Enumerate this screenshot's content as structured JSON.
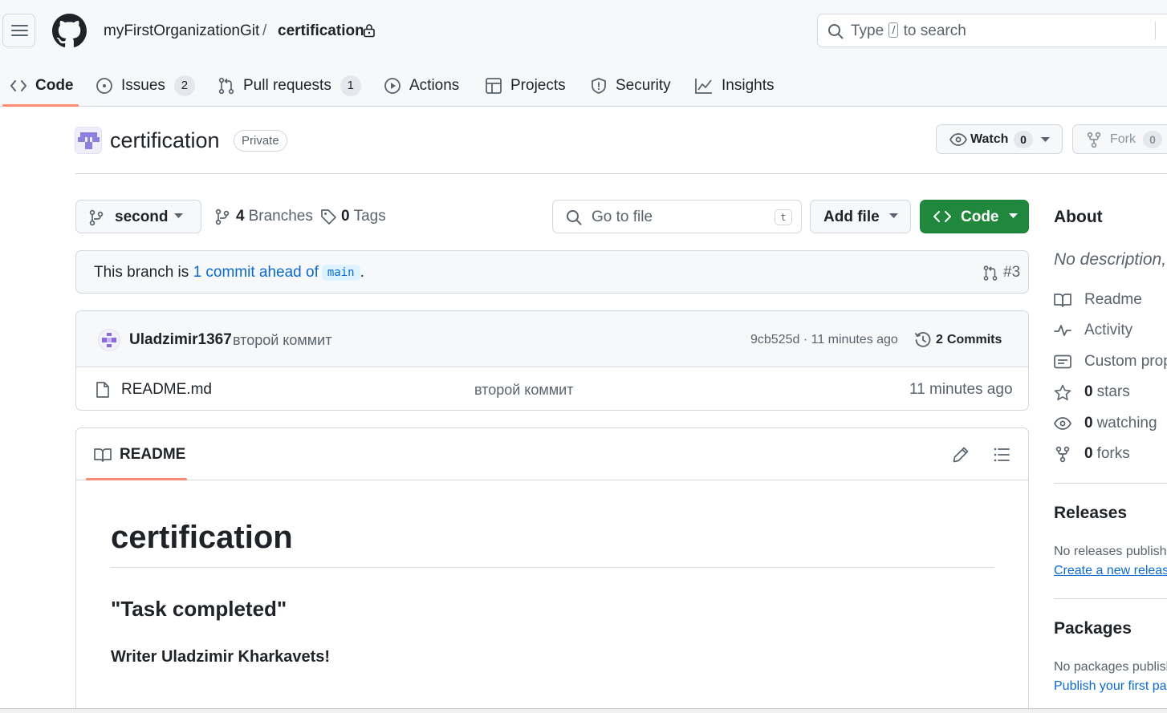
{
  "header": {
    "owner": "myFirstOrganizationGit",
    "separator": "/",
    "repo": "certification",
    "search": {
      "before": "Type",
      "key": "/",
      "after": "to search"
    }
  },
  "nav": {
    "tabs": [
      {
        "label": "Code",
        "icon": "code-icon"
      },
      {
        "label": "Issues",
        "count": "2",
        "icon": "issue-icon"
      },
      {
        "label": "Pull requests",
        "count": "1",
        "icon": "pull-request-icon"
      },
      {
        "label": "Actions",
        "icon": "play-icon"
      },
      {
        "label": "Projects",
        "icon": "table-icon"
      },
      {
        "label": "Security",
        "icon": "shield-icon"
      },
      {
        "label": "Insights",
        "icon": "graph-icon"
      }
    ]
  },
  "repo": {
    "name": "certification",
    "visibility": "Private",
    "watch": {
      "label": "Watch",
      "count": "0"
    },
    "fork": {
      "label": "Fork",
      "count": "0"
    }
  },
  "toolbar": {
    "branch": "second",
    "branches": {
      "count": "4",
      "label": "Branches"
    },
    "tags": {
      "count": "0",
      "label": "Tags"
    },
    "goto_file": "Go to file",
    "goto_key": "t",
    "add_file": "Add file",
    "code": "Code"
  },
  "ahead": {
    "prefix": "This branch is",
    "link": "1 commit ahead of",
    "base": "main",
    "suffix": ".",
    "pr": "#3"
  },
  "commit": {
    "author": "Uladzimir1367",
    "message": "второй коммит",
    "meta": "9cb525d · 11 minutes ago",
    "commits_count": "2",
    "commits_label": "Commits"
  },
  "files": [
    {
      "name": "README.md",
      "message": "второй коммит",
      "time": "11 minutes ago"
    }
  ],
  "readme": {
    "tab": "README",
    "h1": "certification",
    "h2": "\"Task completed\"",
    "p": "Writer Uladzimir Kharkavets!"
  },
  "sidebar": {
    "about": "About",
    "description": "No description,",
    "items": [
      {
        "label": "Readme",
        "icon": "book-icon"
      },
      {
        "label": "Activity",
        "icon": "pulse-icon"
      },
      {
        "label": "Custom prop",
        "icon": "note-icon"
      },
      {
        "count": "0",
        "label": "stars",
        "icon": "star-icon"
      },
      {
        "count": "0",
        "label": "watching",
        "icon": "eye-icon"
      },
      {
        "count": "0",
        "label": "forks",
        "icon": "fork-icon"
      }
    ],
    "releases": {
      "title": "Releases",
      "note": "No releases publishe",
      "link": "Create a new release"
    },
    "packages": {
      "title": "Packages",
      "note": "No packages publish",
      "link": "Publish your first pa"
    }
  },
  "colors": {
    "primary_button": "#1f883d",
    "accent_underline": "#fd8c73",
    "link": "#0969da",
    "muted_text": "#59636e"
  }
}
